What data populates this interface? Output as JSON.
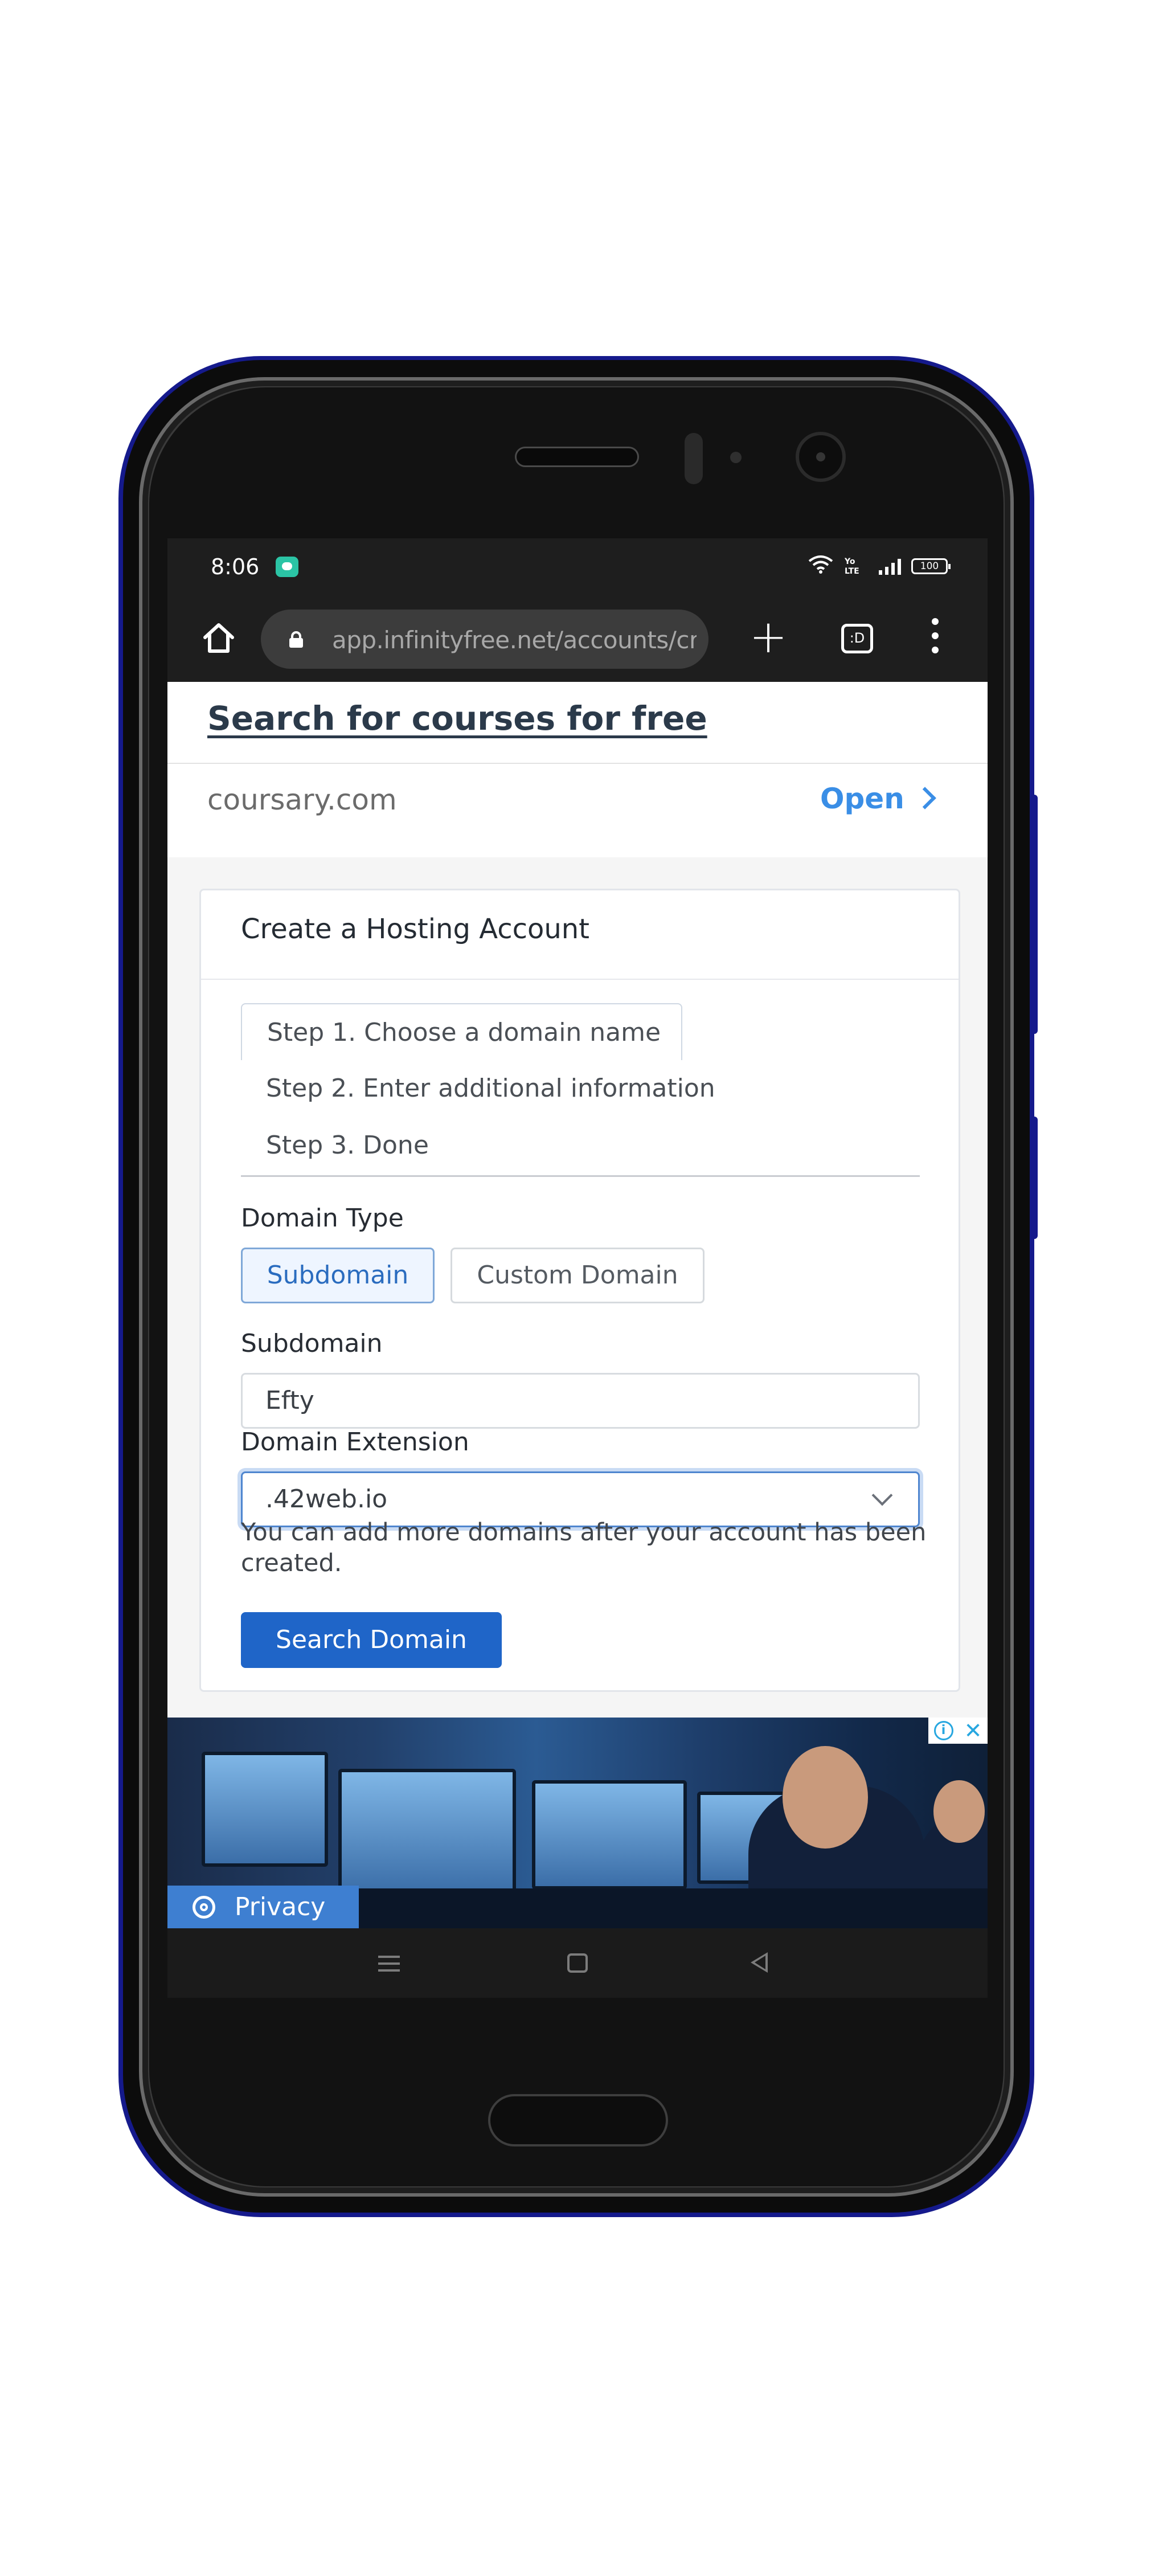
{
  "status_bar": {
    "time": "8:06",
    "network_label": "Yo\nLTE",
    "battery": "100",
    "icons": [
      "message-icon",
      "wifi-icon",
      "lte-icon",
      "signal-icon",
      "battery-icon"
    ]
  },
  "browser": {
    "url": "app.infinityfree.net/accounts/cre",
    "new_tab_label": "+",
    "tab_count_label": ":D",
    "icons": [
      "home-icon",
      "lock-icon",
      "plus-icon",
      "tabs-icon",
      "menu-icon"
    ]
  },
  "top_ad": {
    "headline": "Search for courses for free",
    "domain": "coursary.com",
    "open_label": "Open"
  },
  "card": {
    "title": "Create a Hosting Account",
    "steps": [
      {
        "label": "Step 1. Choose a domain name",
        "active": true
      },
      {
        "label": "Step 2. Enter additional information",
        "active": false
      },
      {
        "label": "Step 3. Done",
        "active": false
      }
    ],
    "domain_type": {
      "label": "Domain Type",
      "options": [
        "Subdomain",
        "Custom Domain"
      ],
      "selected": "Subdomain"
    },
    "subdomain": {
      "label": "Subdomain",
      "value": "Efty"
    },
    "domain_extension": {
      "label": "Domain Extension",
      "selected": ".42web.io"
    },
    "help_text": "You can add more domains after your account has been created.",
    "submit_label": "Search Domain"
  },
  "banner_ad": {
    "info_label": "i",
    "close_label": "✕",
    "privacy_label": "Privacy"
  },
  "colors": {
    "primary": "#1f65c8",
    "link": "#3a8ee6",
    "phone_frame": "#151a8c",
    "status_bar": "#1e1e1e"
  }
}
